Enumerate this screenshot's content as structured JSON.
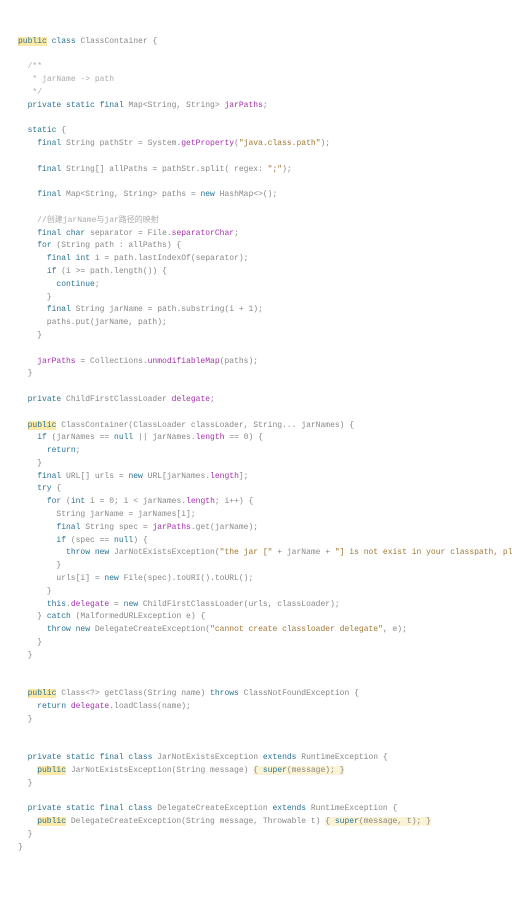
{
  "lines": [
    {
      "t": "<span class='hl'><span class='kw'>public</span></span> <span class='kw'>class</span> ClassContainer {"
    },
    {
      "t": ""
    },
    {
      "t": "  <span class='com'>/**</span>"
    },
    {
      "t": "  <span class='com'> * jarName -> path</span>"
    },
    {
      "t": "  <span class='com'> */</span>"
    },
    {
      "t": "  <span class='kw'>private static final</span> Map&lt;String, String&gt; <span class='fld'>jarPaths</span>;"
    },
    {
      "t": ""
    },
    {
      "t": "  <span class='kw'>static</span> {"
    },
    {
      "t": "    <span class='kw'>final</span> String pathStr = System.<span class='fld'>getProperty</span>(<span class='str'>\"java.class.path\"</span>);"
    },
    {
      "t": ""
    },
    {
      "t": "    <span class='kw'>final</span> String[] allPaths = pathStr.split( regex: <span class='str'>\";\"</span>);"
    },
    {
      "t": ""
    },
    {
      "t": "    <span class='kw'>final</span> Map&lt;String, String&gt; paths = <span class='kw'>new</span> HashMap&lt;&gt;();"
    },
    {
      "t": ""
    },
    {
      "t": "    <span class='com'>//创建jarName与jar路径的映射</span>"
    },
    {
      "t": "    <span class='kw'>final char</span> separator = File.<span class='fld'>separatorChar</span>;"
    },
    {
      "t": "    <span class='kw'>for</span> (String path : allPaths) {"
    },
    {
      "t": "      <span class='kw'>final int</span> i = path.lastIndexOf(separator);"
    },
    {
      "t": "      <span class='kw'>if</span> (i &gt;= path.length()) {"
    },
    {
      "t": "        <span class='kw'>continue</span>;"
    },
    {
      "t": "      }"
    },
    {
      "t": "      <span class='kw'>final</span> String jarName = path.substring(i + 1);"
    },
    {
      "t": "      paths.put(jarName, path);"
    },
    {
      "t": "    }"
    },
    {
      "t": ""
    },
    {
      "t": "    <span class='fld'>jarPaths</span> = Collections.<span class='fld'>unmodifiableMap</span>(paths);"
    },
    {
      "t": "  }"
    },
    {
      "t": ""
    },
    {
      "t": "  <span class='kw'>private</span> ChildFirstClassLoader <span class='fld'>delegate</span>;"
    },
    {
      "t": ""
    },
    {
      "t": "  <span class='hl'><span class='kw'>public</span></span> ClassContainer(ClassLoader classLoader, String... jarNames) {"
    },
    {
      "t": "    <span class='kw'>if</span> (jarNames == <span class='kw'>null</span> || jarNames.<span class='fld'>length</span> == 0) {"
    },
    {
      "t": "      <span class='kw'>return</span>;"
    },
    {
      "t": "    }"
    },
    {
      "t": "    <span class='kw'>final</span> URL[] urls = <span class='kw'>new</span> URL[jarNames.<span class='fld'>length</span>];"
    },
    {
      "t": "    <span class='kw'>try</span> {"
    },
    {
      "t": "      <span class='kw'>for</span> (<span class='kw'>int</span> i = 0; i &lt; jarNames.<span class='fld'>length</span>; i++) {"
    },
    {
      "t": "        String jarName = jarNames[i];"
    },
    {
      "t": "        <span class='kw'>final</span> String spec = <span class='fld'>jarPaths</span>.get(jarName);"
    },
    {
      "t": "        <span class='kw'>if</span> (spec == <span class='kw'>null</span>) {"
    },
    {
      "t": "          <span class='kw'>throw new</span> JarNotExistsException(<span class='str'>\"the jar [\"</span> + jarName + <span class='str'>\"] is not exist in your classpath, please check\"</span>);"
    },
    {
      "t": "        }"
    },
    {
      "t": "        urls[i] = <span class='kw'>new</span> File(spec).toURI().toURL();"
    },
    {
      "t": "      }"
    },
    {
      "t": "      <span class='kw'>this</span>.<span class='fld'>delegate</span> = <span class='kw'>new</span> ChildFirstClassLoader(urls, classLoader);"
    },
    {
      "t": "    } <span class='kw'>catch</span> (MalformedURLException e) {"
    },
    {
      "t": "      <span class='kw'>throw new</span> DelegateCreateException(<span class='str'>\"cannot create classloader delegate\"</span>, e);"
    },
    {
      "t": "    }"
    },
    {
      "t": "  }"
    },
    {
      "t": ""
    },
    {
      "t": ""
    },
    {
      "t": "  <span class='hl'><span class='kw'>public</span></span> Class&lt;?&gt; getClass(String name) <span class='kw'>throws</span> ClassNotFoundException {"
    },
    {
      "t": "    <span class='kw'>return</span> <span class='fld'>delegate</span>.loadClass(name);"
    },
    {
      "t": "  }"
    },
    {
      "t": ""
    },
    {
      "t": ""
    },
    {
      "t": "  <span class='kw'>private static final class</span> JarNotExistsException <span class='kw'>extends</span> RuntimeException {"
    },
    {
      "t": "    <span class='hl'><span class='kw'>public</span></span> JarNotExistsException(String message) <span class='hl2'>{ <span class='kw'>super</span>(message); }</span>"
    },
    {
      "t": "  }"
    },
    {
      "t": ""
    },
    {
      "t": "  <span class='kw'>private static final class</span> DelegateCreateException <span class='kw'>extends</span> RuntimeException {"
    },
    {
      "t": "    <span class='hl'><span class='kw'>public</span></span> DelegateCreateException(String message, Throwable t) <span class='hl2'>{ <span class='kw'>super</span>(message, t); }</span>"
    },
    {
      "t": "  }"
    },
    {
      "t": "}"
    }
  ]
}
